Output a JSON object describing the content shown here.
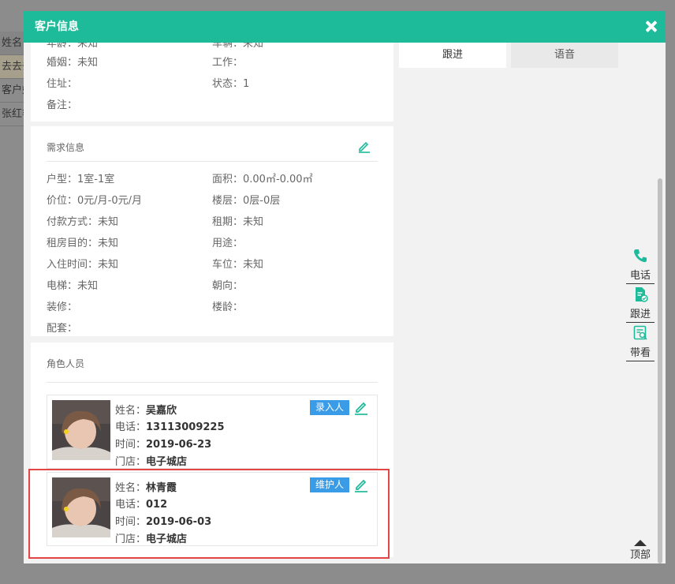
{
  "background": {
    "header_label": "姓名",
    "rows": [
      "去去去",
      "客户姓",
      "张红艳"
    ]
  },
  "modal": {
    "title": "客户信息",
    "close_icon": "close-icon",
    "basic": {
      "age": "年龄：未知",
      "vehicle": "车辆：未知",
      "marriage": "婚姻：未知",
      "job": "工作：",
      "address": "住址：",
      "status": "状态：1",
      "note": "备注："
    },
    "need": {
      "title": "需求信息",
      "house_type": "户型：1室-1室",
      "area": "面积：0.00㎡-0.00㎡",
      "price": "价位：0元/月-0元/月",
      "floor": "楼层：0层-0层",
      "payment": "付款方式：未知",
      "lease_term": "租期：未知",
      "purpose": "租房目的：未知",
      "usage": "用途：",
      "move_in": "入住时间：未知",
      "parking": "车位：未知",
      "elevator": "电梯：未知",
      "orientation": "朝向：",
      "decoration": "装修：",
      "building_age": "楼龄：",
      "facilities": "配套："
    },
    "roles": {
      "title": "角色人员",
      "people": [
        {
          "name_label": "姓名：",
          "name": "吴嘉欣",
          "phone_label": "电话：",
          "phone": "13113009225",
          "time_label": "时间：",
          "time": "2019-06-23",
          "store_label": "门店：",
          "store": "电子城店",
          "role": "录入人"
        },
        {
          "name_label": "姓名：",
          "name": "林青霞",
          "phone_label": "电话：",
          "phone": "012",
          "time_label": "时间：",
          "time": "2019-06-03",
          "store_label": "门店：",
          "store": "电子城店",
          "role": "维护人"
        }
      ]
    },
    "tabs": [
      {
        "label": "跟进",
        "active": true
      },
      {
        "label": "语音",
        "active": false
      }
    ],
    "sidebar": [
      {
        "label": "电话",
        "icon": "phone-icon"
      },
      {
        "label": "跟进",
        "icon": "follow-up-icon"
      },
      {
        "label": "带看",
        "icon": "viewing-icon"
      }
    ],
    "top_button": "顶部",
    "colors": {
      "header": "#1dbb99",
      "badge": "#3a9be6",
      "icon_green": "#1dbb99",
      "highlight": "#e14545"
    }
  }
}
